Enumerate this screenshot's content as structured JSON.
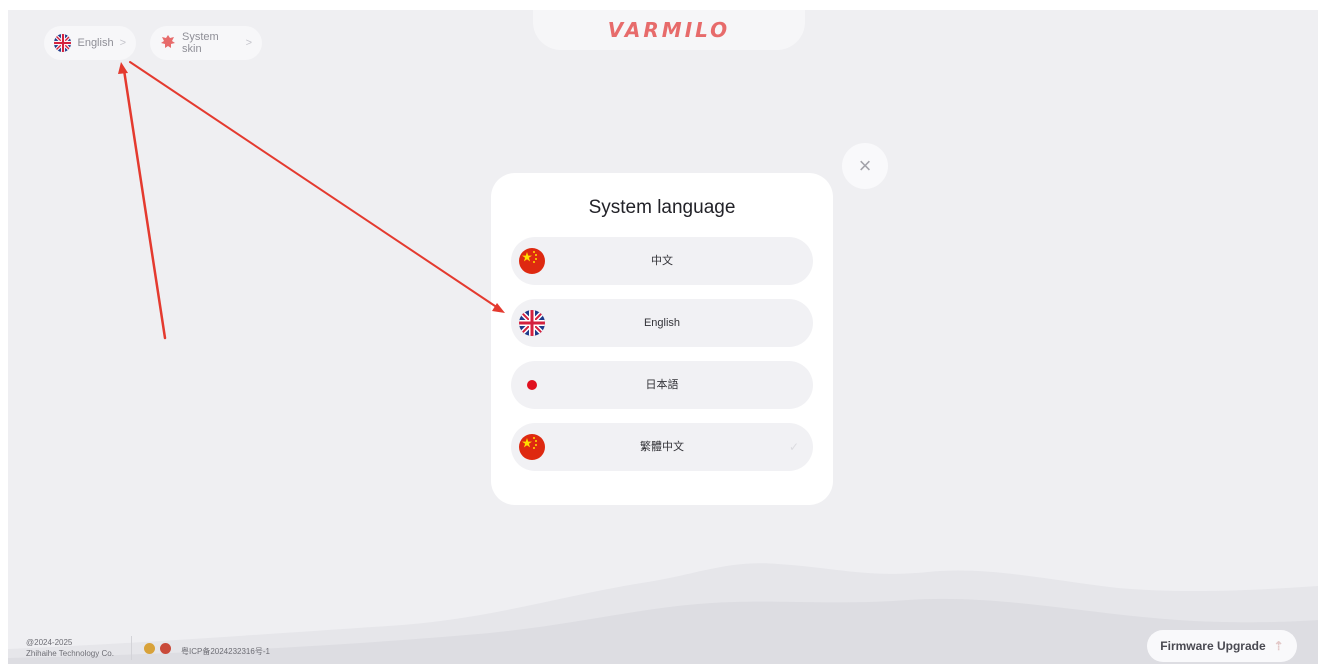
{
  "brand": {
    "logo_text": "VARMILO"
  },
  "header": {
    "language_pill": {
      "label": "English",
      "icon": "uk-flag-icon",
      "chevron": ">"
    },
    "skin_pill": {
      "label": "System skin",
      "icon": "skin-icon",
      "chevron": ">"
    }
  },
  "modal": {
    "title": "System language",
    "close_icon": "close-icon",
    "close_glyph": "×",
    "items": [
      {
        "label": "中文",
        "flag": "china-flag-icon"
      },
      {
        "label": "English",
        "flag": "uk-flag-icon"
      },
      {
        "label": "日本語",
        "flag": "japan-flag-icon"
      },
      {
        "label": "繁體中文",
        "flag": "china-flag-icon",
        "check": "✓"
      }
    ]
  },
  "footer": {
    "copyright_line1": "@2024-2025",
    "copyright_line2": "Zhihaihe Technology Co.",
    "icp": "粤ICP备2024232316号-1",
    "firmware_button": "Firmware Upgrade",
    "firmware_icon": "upload-icon",
    "upload_glyph": "⇡"
  },
  "colors": {
    "background": "#efeff2",
    "accent": "#e76b6b",
    "annotation_arrow": "#e43a2f"
  }
}
